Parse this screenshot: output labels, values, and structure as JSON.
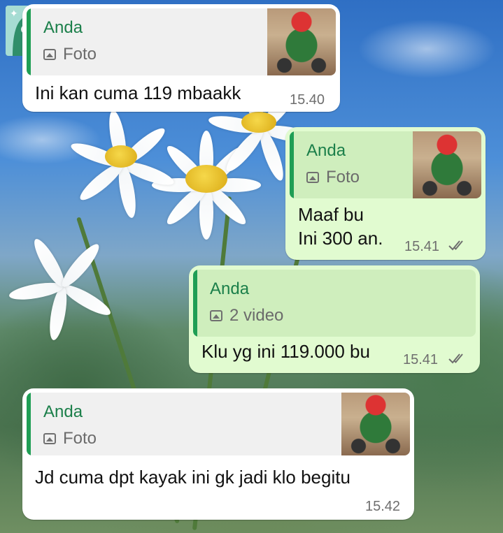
{
  "messages": [
    {
      "direction": "incoming",
      "quote": {
        "author": "Anda",
        "media_label": "Foto",
        "media_icon": "image-icon"
      },
      "text": "Ini kan cuma 119 mbaakk",
      "time": "15.40"
    },
    {
      "direction": "outgoing",
      "quote": {
        "author": "Anda",
        "media_label": "Foto",
        "media_icon": "image-icon"
      },
      "text_lines": [
        "Maaf bu",
        "Ini 300 an."
      ],
      "time": "15.41",
      "status_icon": "double-check-icon"
    },
    {
      "direction": "outgoing",
      "quote": {
        "author": "Anda",
        "media_label": "2 video",
        "media_icon": "image-icon"
      },
      "text": "Klu yg ini 119.000 bu",
      "time": "15.41",
      "status_icon": "double-check-icon"
    },
    {
      "direction": "incoming",
      "quote": {
        "author": "Anda",
        "media_label": "Foto",
        "media_icon": "image-icon"
      },
      "text": "Jd cuma dpt kayak ini gk jadi klo begitu",
      "time": "15.42"
    }
  ],
  "colors": {
    "incoming_bubble": "#ffffff",
    "outgoing_bubble": "#e1fbd0",
    "quote_accent": "#1f9e55",
    "timestamp": "#6e6e6e"
  }
}
